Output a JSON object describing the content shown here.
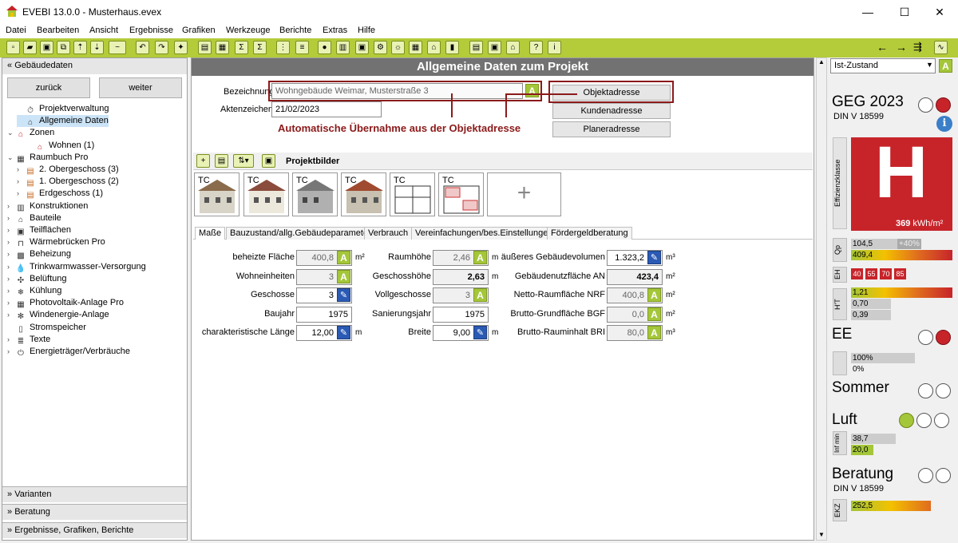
{
  "window": {
    "title": "EVEBI 13.0.0 - Musterhaus.evex"
  },
  "menu": [
    "Datei",
    "Bearbeiten",
    "Ansicht",
    "Ergebnisse",
    "Grafiken",
    "Werkzeuge",
    "Berichte",
    "Extras",
    "Hilfe"
  ],
  "left": {
    "header": "Gebäudedaten",
    "back": "zurück",
    "next": "weiter",
    "tree": [
      {
        "label": "Projektverwaltung",
        "level": 1,
        "expander": "",
        "icon": "stopwatch-icon",
        "glyph": "⏱"
      },
      {
        "label": "Allgemeine Daten",
        "level": 1,
        "expander": "",
        "icon": "house-icon",
        "glyph": "⌂"
      },
      {
        "label": "Zonen",
        "level": 0,
        "expander": "v",
        "icon": "house-red-icon",
        "glyph": "⌂"
      },
      {
        "label": "Wohnen (1)",
        "level": 2,
        "expander": "",
        "icon": "house-red-icon",
        "glyph": "⌂"
      },
      {
        "label": "Raumbuch Pro",
        "level": 0,
        "expander": "v",
        "icon": "book-icon",
        "glyph": "▦"
      },
      {
        "label": "2. Obergeschoss (3)",
        "level": 1,
        "expander": ">",
        "icon": "floor-icon",
        "glyph": "▤"
      },
      {
        "label": "1. Obergeschoss (2)",
        "level": 1,
        "expander": ">",
        "icon": "floor-icon",
        "glyph": "▤"
      },
      {
        "label": "Erdgeschoss (1)",
        "level": 1,
        "expander": ">",
        "icon": "floor-icon",
        "glyph": "▤"
      },
      {
        "label": "Konstruktionen",
        "level": 0,
        "expander": ">",
        "icon": "wall-icon",
        "glyph": "▥"
      },
      {
        "label": "Bauteile",
        "level": 0,
        "expander": ">",
        "icon": "house-outline-icon",
        "glyph": "⌂"
      },
      {
        "label": "Teilflächen",
        "level": 0,
        "expander": ">",
        "icon": "area-icon",
        "glyph": "▣"
      },
      {
        "label": "Wärmebrücken Pro",
        "level": 0,
        "expander": ">",
        "icon": "bridge-icon",
        "glyph": "⊓"
      },
      {
        "label": "Beheizung",
        "level": 0,
        "expander": ">",
        "icon": "heating-icon",
        "glyph": "▩"
      },
      {
        "label": "Trinkwarmwasser-Versorgung",
        "level": 0,
        "expander": ">",
        "icon": "water-drop-icon",
        "glyph": "💧"
      },
      {
        "label": "Belüftung",
        "level": 0,
        "expander": ">",
        "icon": "fan-icon",
        "glyph": "✣"
      },
      {
        "label": "Kühlung",
        "level": 0,
        "expander": ">",
        "icon": "snowflake-icon",
        "glyph": "❄"
      },
      {
        "label": "Photovoltaik-Anlage Pro",
        "level": 0,
        "expander": ">",
        "icon": "solar-icon",
        "glyph": "▦"
      },
      {
        "label": "Windenergie-Anlage",
        "level": 0,
        "expander": ">",
        "icon": "wind-icon",
        "glyph": "✻"
      },
      {
        "label": "Stromspeicher",
        "level": 0,
        "expander": "",
        "icon": "battery-icon",
        "glyph": "▯"
      },
      {
        "label": "Texte",
        "level": 0,
        "expander": ">",
        "icon": "text-icon",
        "glyph": "≣"
      },
      {
        "label": "Energieträger/Verbräuche",
        "level": 0,
        "expander": ">",
        "icon": "plug-icon",
        "glyph": "⏻"
      }
    ],
    "sections": [
      "Varianten",
      "Beratung",
      "Ergebnisse, Grafiken, Berichte"
    ]
  },
  "center": {
    "title": "Allgemeine Daten zum Projekt",
    "bezeichnung_label": "Bezeichnung",
    "bezeichnung_value": "Wohngebäude Weimar, Musterstraße 3",
    "aktenzeichen_label": "Aktenzeichen",
    "aktenzeichen_value": "21/02/2023",
    "btn_objekt": "Objektadresse",
    "btn_kunden": "Kundenadresse",
    "btn_planer": "Planeradresse",
    "annotation": "Automatische Übernahme aus der Objektadresse",
    "projektbilder": "Projektbilder",
    "add_glyph": "+",
    "tabs": [
      "Maße",
      "Bauzustand/allg.Gebäudeparameter",
      "Verbrauch",
      "Vereinfachungen/bes.Einstellungen",
      "Fördergeldberatung"
    ],
    "col1": [
      {
        "label": "beheizte Fläche",
        "value": "400,8",
        "badge": "A",
        "unit": "m²",
        "grey": true
      },
      {
        "label": "Wohneinheiten",
        "value": "3",
        "badge": "A",
        "unit": "",
        "grey": true
      },
      {
        "label": "Geschosse",
        "value": "3",
        "badge": "pen",
        "unit": "",
        "grey": false
      },
      {
        "label": "Baujahr",
        "value": "1975",
        "badge": "",
        "unit": "",
        "grey": false
      },
      {
        "label": "charakteristische Länge",
        "value": "12,00",
        "badge": "pen",
        "unit": "m",
        "grey": false
      }
    ],
    "col2": [
      {
        "label": "Raumhöhe",
        "value": "2,46",
        "badge": "A",
        "unit": "m",
        "grey": true
      },
      {
        "label": "Geschosshöhe",
        "value": "2,63",
        "badge": "",
        "unit": "m",
        "grey": true,
        "bold": true
      },
      {
        "label": "Vollgeschosse",
        "value": "3",
        "badge": "A",
        "unit": "",
        "grey": true
      },
      {
        "label": "Sanierungsjahr",
        "value": "1975",
        "badge": "",
        "unit": "",
        "grey": false
      },
      {
        "label": "Breite",
        "value": "9,00",
        "badge": "pen",
        "unit": "m",
        "grey": false
      }
    ],
    "col3": [
      {
        "label": "äußeres Gebäudevolumen",
        "value": "1.323,2",
        "badge": "pen",
        "unit": "m³",
        "grey": false
      },
      {
        "label": "Gebäudenutzfläche AN",
        "value": "423,4",
        "badge": "",
        "unit": "m²",
        "grey": true,
        "bold": true
      },
      {
        "label": "Netto-Raumfläche NRF",
        "value": "400,8",
        "badge": "A",
        "unit": "m²",
        "grey": true
      },
      {
        "label": "Brutto-Grundfläche BGF",
        "value": "0,0",
        "badge": "A",
        "unit": "m²",
        "grey": true
      },
      {
        "label": "Brutto-Rauminhalt BRI",
        "value": "80,0",
        "badge": "A",
        "unit": "m³",
        "grey": true
      }
    ]
  },
  "right": {
    "state": "Ist-Zustand",
    "state_badge": "A",
    "geg": "GEG 2023",
    "din": "DIN V 18599",
    "info": "i",
    "effizienzklasse_label": "Effizienzklasse",
    "klasse": "H",
    "kwh_value": "369",
    "kwh_unit": "kWh/m²",
    "qp_label": "Qp",
    "qp_values": [
      "104,5",
      "+40%",
      "409,4"
    ],
    "eh_label": "EH",
    "eh_values": [
      "40",
      "55",
      "70",
      "85"
    ],
    "ht_label": "H'T",
    "ht_values": [
      "1,21",
      "0,70",
      "0,39"
    ],
    "ee": "EE",
    "ee_values": [
      "100%",
      "0%"
    ],
    "sommer": "Sommer",
    "luft": "Luft",
    "inf_label": "Inf min",
    "luft_values": [
      "38,7",
      "20,0"
    ],
    "beratung": "Beratung",
    "beratung_din": "DIN V 18599",
    "ekz_label": "EKZ",
    "ekz_value": "252,5",
    "colors": {
      "klasse_red": "#c7242a",
      "green": "#a4c639",
      "blue": "#2a5ab4"
    }
  }
}
